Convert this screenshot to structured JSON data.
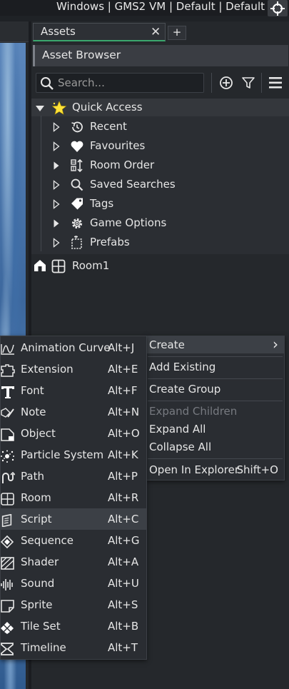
{
  "topbar": {
    "targets": "Windows | GMS2 VM | Default | Default",
    "target_icon": "crosshair-icon"
  },
  "panel": {
    "tab_label": "Assets",
    "tab_close": "✕",
    "tab_add": "+",
    "browser_title": "Asset Browser",
    "search_placeholder": "Search...",
    "accent_color": "#3aa76d"
  },
  "tree": {
    "quick_access": "Quick Access",
    "items": [
      {
        "label": "Recent",
        "icon": "history-icon",
        "filled_chevron": false
      },
      {
        "label": "Favourites",
        "icon": "heart-icon",
        "filled_chevron": false
      },
      {
        "label": "Room Order",
        "icon": "room-order-icon",
        "filled_chevron": true
      },
      {
        "label": "Saved Searches",
        "icon": "search-icon",
        "filled_chevron": false
      },
      {
        "label": "Tags",
        "icon": "tag-icon",
        "filled_chevron": false
      },
      {
        "label": "Game Options",
        "icon": "gear-icon",
        "filled_chevron": true
      },
      {
        "label": "Prefabs",
        "icon": "prefab-icon",
        "filled_chevron": false
      }
    ],
    "room": "Room1"
  },
  "context_menu": {
    "create": "Create",
    "create_arrow": "›",
    "add_existing": "Add Existing",
    "create_group": "Create Group",
    "expand_children": "Expand Children",
    "expand_all": "Expand All",
    "collapse_all": "Collapse All",
    "open_in_explorer": "Open In Explorer",
    "open_in_explorer_shortcut": "Shift+O"
  },
  "create_submenu": [
    {
      "label": "Animation Curve",
      "shortcut": "Alt+J",
      "icon": "animation-curve-icon"
    },
    {
      "label": "Extension",
      "shortcut": "Alt+E",
      "icon": "extension-icon"
    },
    {
      "label": "Font",
      "shortcut": "Alt+F",
      "icon": "font-icon"
    },
    {
      "label": "Note",
      "shortcut": "Alt+N",
      "icon": "note-icon"
    },
    {
      "label": "Object",
      "shortcut": "Alt+O",
      "icon": "object-icon"
    },
    {
      "label": "Particle System",
      "shortcut": "Alt+K",
      "icon": "particle-system-icon"
    },
    {
      "label": "Path",
      "shortcut": "Alt+P",
      "icon": "path-icon"
    },
    {
      "label": "Room",
      "shortcut": "Alt+R",
      "icon": "room-icon"
    },
    {
      "label": "Script",
      "shortcut": "Alt+C",
      "icon": "script-icon",
      "selected": true
    },
    {
      "label": "Sequence",
      "shortcut": "Alt+G",
      "icon": "sequence-icon"
    },
    {
      "label": "Shader",
      "shortcut": "Alt+A",
      "icon": "shader-icon"
    },
    {
      "label": "Sound",
      "shortcut": "Alt+U",
      "icon": "sound-icon"
    },
    {
      "label": "Sprite",
      "shortcut": "Alt+S",
      "icon": "sprite-icon"
    },
    {
      "label": "Tile Set",
      "shortcut": "Alt+B",
      "icon": "tile-set-icon"
    },
    {
      "label": "Timeline",
      "shortcut": "Alt+T",
      "icon": "timeline-icon"
    }
  ]
}
